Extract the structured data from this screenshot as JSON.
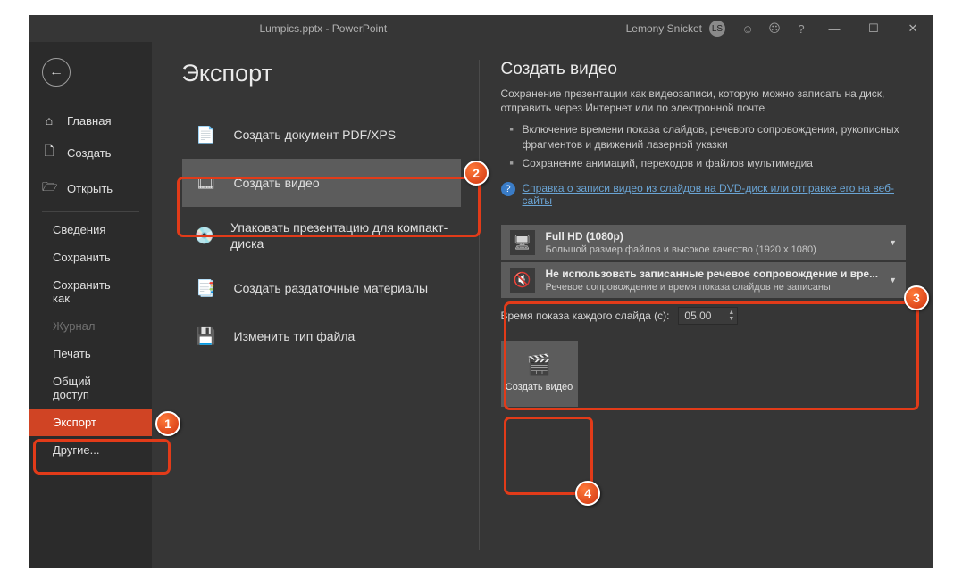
{
  "titlebar": {
    "title": "Lumpics.pptx  -  PowerPoint",
    "user": "Lemony Snicket",
    "initials": "LS"
  },
  "sidebar": {
    "top": [
      {
        "icon": "⌂",
        "label": "Главная"
      },
      {
        "icon": "🗋",
        "label": "Создать"
      },
      {
        "icon": "🗁",
        "label": "Открыть"
      }
    ],
    "sub": [
      {
        "label": "Сведения"
      },
      {
        "label": "Сохранить"
      },
      {
        "label": "Сохранить как"
      },
      {
        "label": "Журнал",
        "disabled": true
      },
      {
        "label": "Печать"
      },
      {
        "label": "Общий доступ"
      },
      {
        "label": "Экспорт",
        "active": true
      },
      {
        "label": "Другие..."
      }
    ]
  },
  "page": {
    "heading": "Экспорт",
    "items": [
      {
        "label": "Создать документ PDF/XPS"
      },
      {
        "label": "Создать видео",
        "selected": true
      },
      {
        "label": "Упаковать презентацию для компакт-диска"
      },
      {
        "label": "Создать раздаточные материалы"
      },
      {
        "label": "Изменить тип файла"
      }
    ]
  },
  "detail": {
    "heading": "Создать видео",
    "desc": "Сохранение презентации как видеозаписи, которую можно записать на диск, отправить через Интернет или по электронной почте",
    "bullets": [
      "Включение времени показа слайдов, речевого сопровождения, рукописных фрагментов и движений лазерной указки",
      "Сохранение анимаций, переходов и файлов мультимедиа"
    ],
    "help": "Справка о записи видео из слайдов на DVD-диск или отправке его на веб-сайты",
    "quality": {
      "title": "Full HD (1080p)",
      "sub": "Большой размер файлов и высокое качество (1920 x 1080)"
    },
    "narr": {
      "title": "Не использовать записанные речевое сопровождение и вре...",
      "sub": "Речевое сопровождение и время показа слайдов не записаны"
    },
    "duration": {
      "label": "Время показа каждого слайда (с):",
      "value": "05.00"
    },
    "button": "Создать видео"
  },
  "annotations": {
    "n1": "1",
    "n2": "2",
    "n3": "3",
    "n4": "4"
  }
}
